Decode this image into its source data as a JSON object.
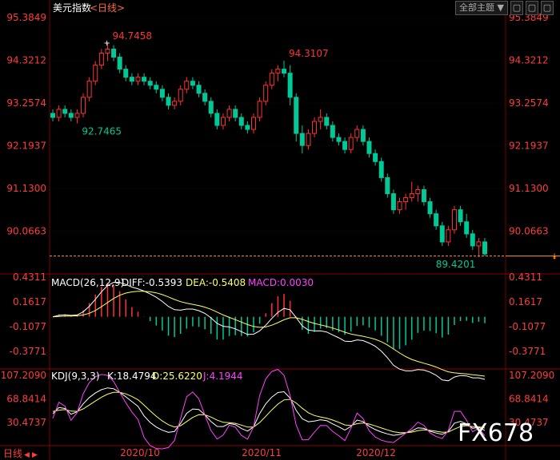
{
  "header": {
    "instrument": "美元指数",
    "period": "<日线>",
    "subject_dropdown": "全部主题",
    "dropdown_arrow": "▼",
    "btn_min": "▢",
    "btn_max": "▢",
    "btn_close": "▢"
  },
  "price_panel": {
    "y_ticks": [
      "95.3849",
      "94.3212",
      "93.2574",
      "92.1937",
      "91.1300",
      "90.0663"
    ],
    "annotations": {
      "high1": "94.7458",
      "low1": "92.7465",
      "high2": "94.3107",
      "last": "89.4201"
    }
  },
  "macd_panel": {
    "label_main": "MACD(26,12,9)",
    "label_diff": "DIFF:-0.5393",
    "label_dea": "DEA:-0.5408",
    "label_macd": "MACD:0.0030",
    "y_ticks": [
      "0.4311",
      "0.1617",
      "-0.1077",
      "-0.3771"
    ]
  },
  "kdj_panel": {
    "label_main": "KDJ(9,3,3)",
    "label_k": "K:18.4794",
    "label_d": "D:25.6220",
    "label_j": "J:4.1944",
    "y_ticks": [
      "107.2090",
      "68.8414",
      "30.4737"
    ]
  },
  "bottom": {
    "period_button": "日线",
    "x_labels": [
      "2020/10",
      "2020/11",
      "2020/12"
    ]
  },
  "watermark": "FX678",
  "colors": {
    "up": "#ff3232",
    "down": "#00c896",
    "tick_text": "#ff3b3b",
    "grid": "#7a0000",
    "diff": "#ffffff",
    "dea": "#ffff66",
    "macd_label": "#ff40ff",
    "kdj_k": "#ffffff",
    "kdj_d": "#ffff66",
    "kdj_j": "#ff40ff",
    "last_line": "#ff8c00"
  },
  "chart_data": {
    "type": "candlestick",
    "approx_ohlc": [
      [
        93.0,
        93.1,
        92.8,
        92.9
      ],
      [
        92.9,
        93.2,
        92.8,
        93.1
      ],
      [
        93.1,
        93.2,
        92.9,
        93.0
      ],
      [
        93.0,
        93.1,
        92.8,
        92.9
      ],
      [
        92.9,
        93.1,
        92.75,
        93.0
      ],
      [
        93.0,
        93.5,
        92.9,
        93.4
      ],
      [
        93.4,
        93.9,
        93.3,
        93.8
      ],
      [
        93.8,
        94.3,
        93.7,
        94.2
      ],
      [
        94.2,
        94.6,
        94.1,
        94.5
      ],
      [
        94.5,
        94.75,
        94.3,
        94.6
      ],
      [
        94.6,
        94.7,
        94.3,
        94.4
      ],
      [
        94.4,
        94.5,
        94.0,
        94.1
      ],
      [
        94.1,
        94.2,
        93.8,
        93.9
      ],
      [
        93.9,
        94.0,
        93.7,
        93.8
      ],
      [
        93.8,
        94.0,
        93.7,
        93.9
      ],
      [
        93.9,
        94.0,
        93.7,
        93.8
      ],
      [
        93.8,
        93.9,
        93.6,
        93.7
      ],
      [
        93.7,
        93.8,
        93.5,
        93.6
      ],
      [
        93.6,
        93.7,
        93.3,
        93.4
      ],
      [
        93.4,
        93.5,
        93.1,
        93.2
      ],
      [
        93.2,
        93.4,
        93.1,
        93.3
      ],
      [
        93.3,
        93.7,
        93.2,
        93.6
      ],
      [
        93.6,
        93.9,
        93.5,
        93.8
      ],
      [
        93.8,
        93.9,
        93.6,
        93.7
      ],
      [
        93.7,
        93.8,
        93.4,
        93.5
      ],
      [
        93.5,
        93.6,
        93.2,
        93.3
      ],
      [
        93.3,
        93.4,
        92.9,
        93.0
      ],
      [
        93.0,
        93.1,
        92.6,
        92.7
      ],
      [
        92.7,
        93.0,
        92.6,
        92.9
      ],
      [
        92.9,
        93.2,
        92.8,
        93.1
      ],
      [
        93.1,
        93.2,
        92.8,
        92.9
      ],
      [
        92.9,
        93.0,
        92.6,
        92.7
      ],
      [
        92.7,
        92.8,
        92.5,
        92.6
      ],
      [
        92.6,
        93.0,
        92.5,
        92.9
      ],
      [
        92.9,
        93.4,
        92.8,
        93.3
      ],
      [
        93.3,
        93.8,
        93.2,
        93.7
      ],
      [
        93.7,
        94.1,
        93.6,
        94.0
      ],
      [
        94.0,
        94.2,
        93.8,
        94.1
      ],
      [
        94.1,
        94.31,
        93.9,
        94.0
      ],
      [
        94.0,
        94.2,
        93.2,
        93.4
      ],
      [
        93.4,
        93.5,
        92.3,
        92.5
      ],
      [
        92.5,
        92.7,
        92.0,
        92.2
      ],
      [
        92.2,
        92.6,
        92.1,
        92.5
      ],
      [
        92.5,
        92.9,
        92.4,
        92.8
      ],
      [
        92.8,
        93.1,
        92.6,
        92.9
      ],
      [
        92.9,
        93.0,
        92.6,
        92.7
      ],
      [
        92.7,
        92.8,
        92.3,
        92.4
      ],
      [
        92.4,
        92.5,
        92.2,
        92.3
      ],
      [
        92.3,
        92.4,
        92.0,
        92.1
      ],
      [
        92.1,
        92.5,
        92.0,
        92.4
      ],
      [
        92.4,
        92.7,
        92.3,
        92.6
      ],
      [
        92.6,
        92.7,
        92.2,
        92.3
      ],
      [
        92.3,
        92.4,
        91.9,
        92.0
      ],
      [
        92.0,
        92.1,
        91.7,
        91.8
      ],
      [
        91.8,
        91.9,
        91.3,
        91.4
      ],
      [
        91.4,
        91.5,
        90.9,
        91.0
      ],
      [
        91.0,
        91.1,
        90.5,
        90.6
      ],
      [
        90.6,
        90.9,
        90.5,
        90.8
      ],
      [
        90.8,
        91.0,
        90.6,
        90.9
      ],
      [
        90.9,
        91.3,
        90.8,
        91.0
      ],
      [
        91.0,
        91.2,
        90.8,
        91.1
      ],
      [
        91.1,
        91.2,
        90.7,
        90.8
      ],
      [
        90.8,
        90.9,
        90.4,
        90.5
      ],
      [
        90.5,
        90.6,
        90.1,
        90.2
      ],
      [
        90.2,
        90.3,
        89.7,
        89.8
      ],
      [
        89.8,
        90.2,
        89.7,
        90.1
      ],
      [
        90.1,
        90.7,
        90.0,
        90.6
      ],
      [
        90.6,
        90.7,
        90.2,
        90.3
      ],
      [
        90.3,
        90.5,
        89.9,
        90.0
      ],
      [
        90.0,
        90.1,
        89.6,
        89.7
      ],
      [
        89.7,
        89.9,
        89.42,
        89.8
      ],
      [
        89.8,
        89.9,
        89.45,
        89.5
      ]
    ]
  }
}
